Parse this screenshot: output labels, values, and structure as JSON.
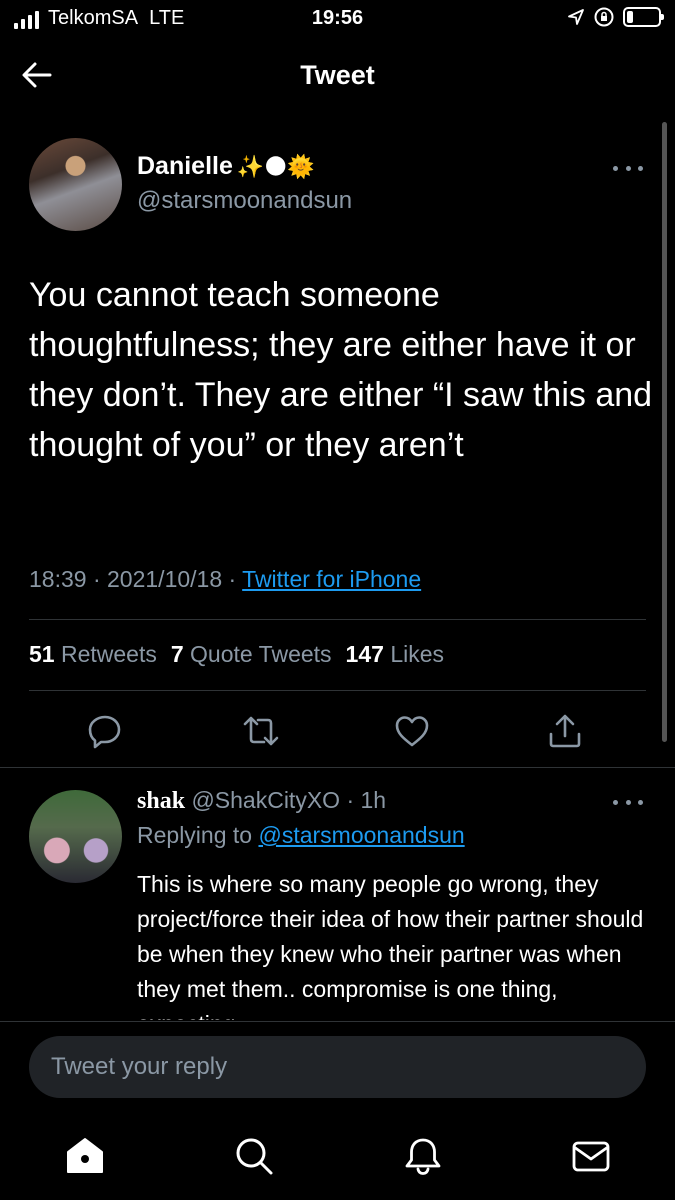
{
  "status_bar": {
    "carrier": "TelkomSA",
    "network": "LTE",
    "time": "19:56"
  },
  "header": {
    "title": "Tweet",
    "back_icon": "arrow-left-icon"
  },
  "tweet": {
    "author_name": "Danielle",
    "name_emojis": "✨🌑🌞",
    "handle": "@starsmoonandsun",
    "text": "You cannot teach someone thoughtfulness; they are either have it or they don’t. They are either “I saw this and thought of you” or they aren’t",
    "time": "18:39",
    "date": "2021/10/18",
    "source": "Twitter for iPhone",
    "separator": " · ",
    "stats": {
      "retweets_count": "51",
      "retweets_label": "Retweets",
      "quotes_count": "7",
      "quotes_label": "Quote Tweets",
      "likes_count": "147",
      "likes_label": "Likes"
    },
    "actions": [
      "reply-icon",
      "retweet-icon",
      "like-icon",
      "share-icon"
    ]
  },
  "reply": {
    "name": "shak",
    "handle": "@ShakCityXO",
    "time": "1h",
    "replying_prefix": "Replying to",
    "replying_handle": "@starsmoonandsun",
    "text": "This is where so many people go wrong, they project/force their idea of how their partner should be when they knew who their partner was when they met them.. compromise is one thing, expecting"
  },
  "composer": {
    "placeholder": "Tweet your reply"
  },
  "tab_bar": [
    "home-icon",
    "search-icon",
    "notifications-icon",
    "messages-icon"
  ],
  "colors": {
    "background": "#000000",
    "accent": "#1d9bf0",
    "secondary_text": "#8b98a5",
    "divider": "#2f3336"
  }
}
